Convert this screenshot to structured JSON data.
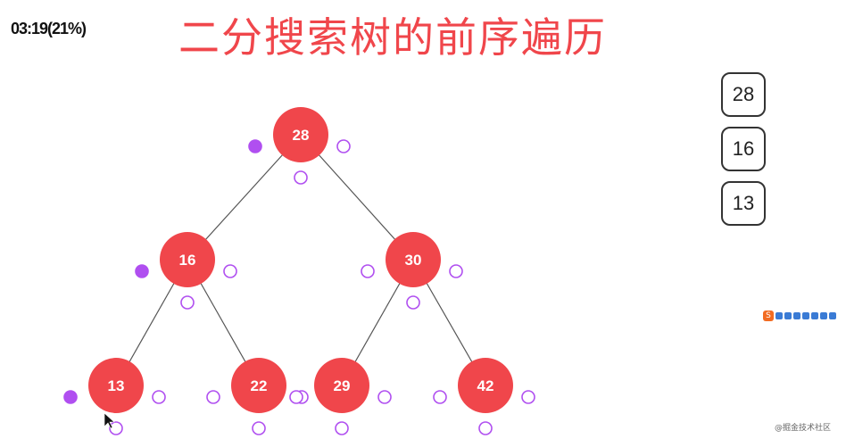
{
  "timestamp": "03:19(21%)",
  "title": "二分搜索树的前序遍历",
  "tree": {
    "node_color": "#f0464b",
    "marker_color": "#b04ff0",
    "nodes": [
      {
        "id": "n28",
        "label": "28"
      },
      {
        "id": "n16",
        "label": "16"
      },
      {
        "id": "n30",
        "label": "30"
      },
      {
        "id": "n13",
        "label": "13"
      },
      {
        "id": "n22",
        "label": "22"
      },
      {
        "id": "n29",
        "label": "29"
      },
      {
        "id": "n42",
        "label": "42"
      }
    ],
    "edges": [
      [
        "n28",
        "n16"
      ],
      [
        "n28",
        "n30"
      ],
      [
        "n16",
        "n13"
      ],
      [
        "n16",
        "n22"
      ],
      [
        "n30",
        "n29"
      ],
      [
        "n30",
        "n42"
      ]
    ],
    "visited_markers": {
      "n28": [
        "left"
      ],
      "n16": [
        "left"
      ],
      "n13": [
        "left"
      ]
    }
  },
  "output_stack": [
    "28",
    "16",
    "13"
  ],
  "toolbar": {
    "logo_glyph": "S",
    "logo_color": "#f26b21"
  },
  "watermark": "@掘金技术社区"
}
